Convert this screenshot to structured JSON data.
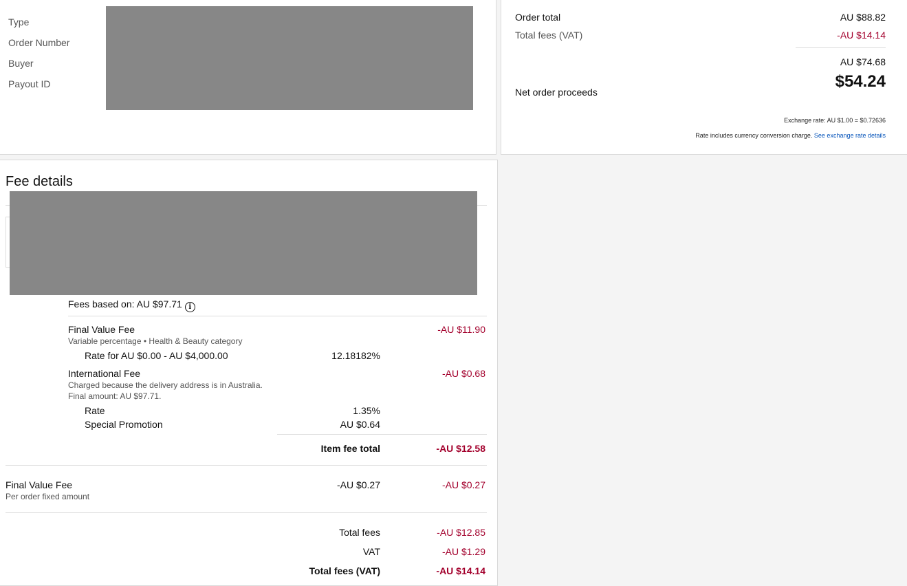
{
  "order_info": {
    "labels": [
      "Type",
      "Order Number",
      "Buyer",
      "Payout ID"
    ]
  },
  "summary": {
    "order_total_label": "Order total",
    "order_total_value": "AU $88.82",
    "total_fees_label": "Total fees (VAT)",
    "total_fees_value": "-AU $14.14",
    "subtotal_value": "AU $74.68",
    "net_label": "Net order proceeds",
    "net_value": "$54.24",
    "exchange_rate": "Exchange rate: AU $1.00 = $0.72636",
    "rate_note": "Rate includes currency conversion charge.",
    "rate_link": "See exchange rate details"
  },
  "fee_details": {
    "title": "Fee details",
    "fees_based_on": "Fees based on: AU $97.71",
    "info_icon": "info-icon",
    "fvf": {
      "title": "Final Value Fee",
      "sub": "Variable percentage • Health & Beauty category",
      "amount": "-AU $11.90",
      "rate_label": "Rate for AU $0.00 - AU $4,000.00",
      "rate_value": "12.18182%"
    },
    "intl": {
      "title": "International Fee",
      "sub1": "Charged because the delivery address is in Australia.",
      "sub2": "Final amount: AU $97.71.",
      "amount": "-AU $0.68",
      "rate_label": "Rate",
      "rate_value": "1.35%",
      "promo_label": "Special Promotion",
      "promo_value": "AU $0.64"
    },
    "item_fee_total_label": "Item fee total",
    "item_fee_total_value": "-AU $12.58",
    "fvf_fixed": {
      "title": "Final Value Fee",
      "sub": "Per order fixed amount",
      "mid": "-AU $0.27",
      "amount": "-AU $0.27"
    },
    "totals": {
      "total_fees_label": "Total fees",
      "total_fees_value": "-AU $12.85",
      "vat_label": "VAT",
      "vat_value": "-AU $1.29",
      "total_vat_label": "Total fees (VAT)",
      "total_vat_value": "-AU $14.14"
    }
  },
  "colors": {
    "negative": "#a3002c",
    "link": "#0654ba",
    "redaction": "#878787"
  }
}
